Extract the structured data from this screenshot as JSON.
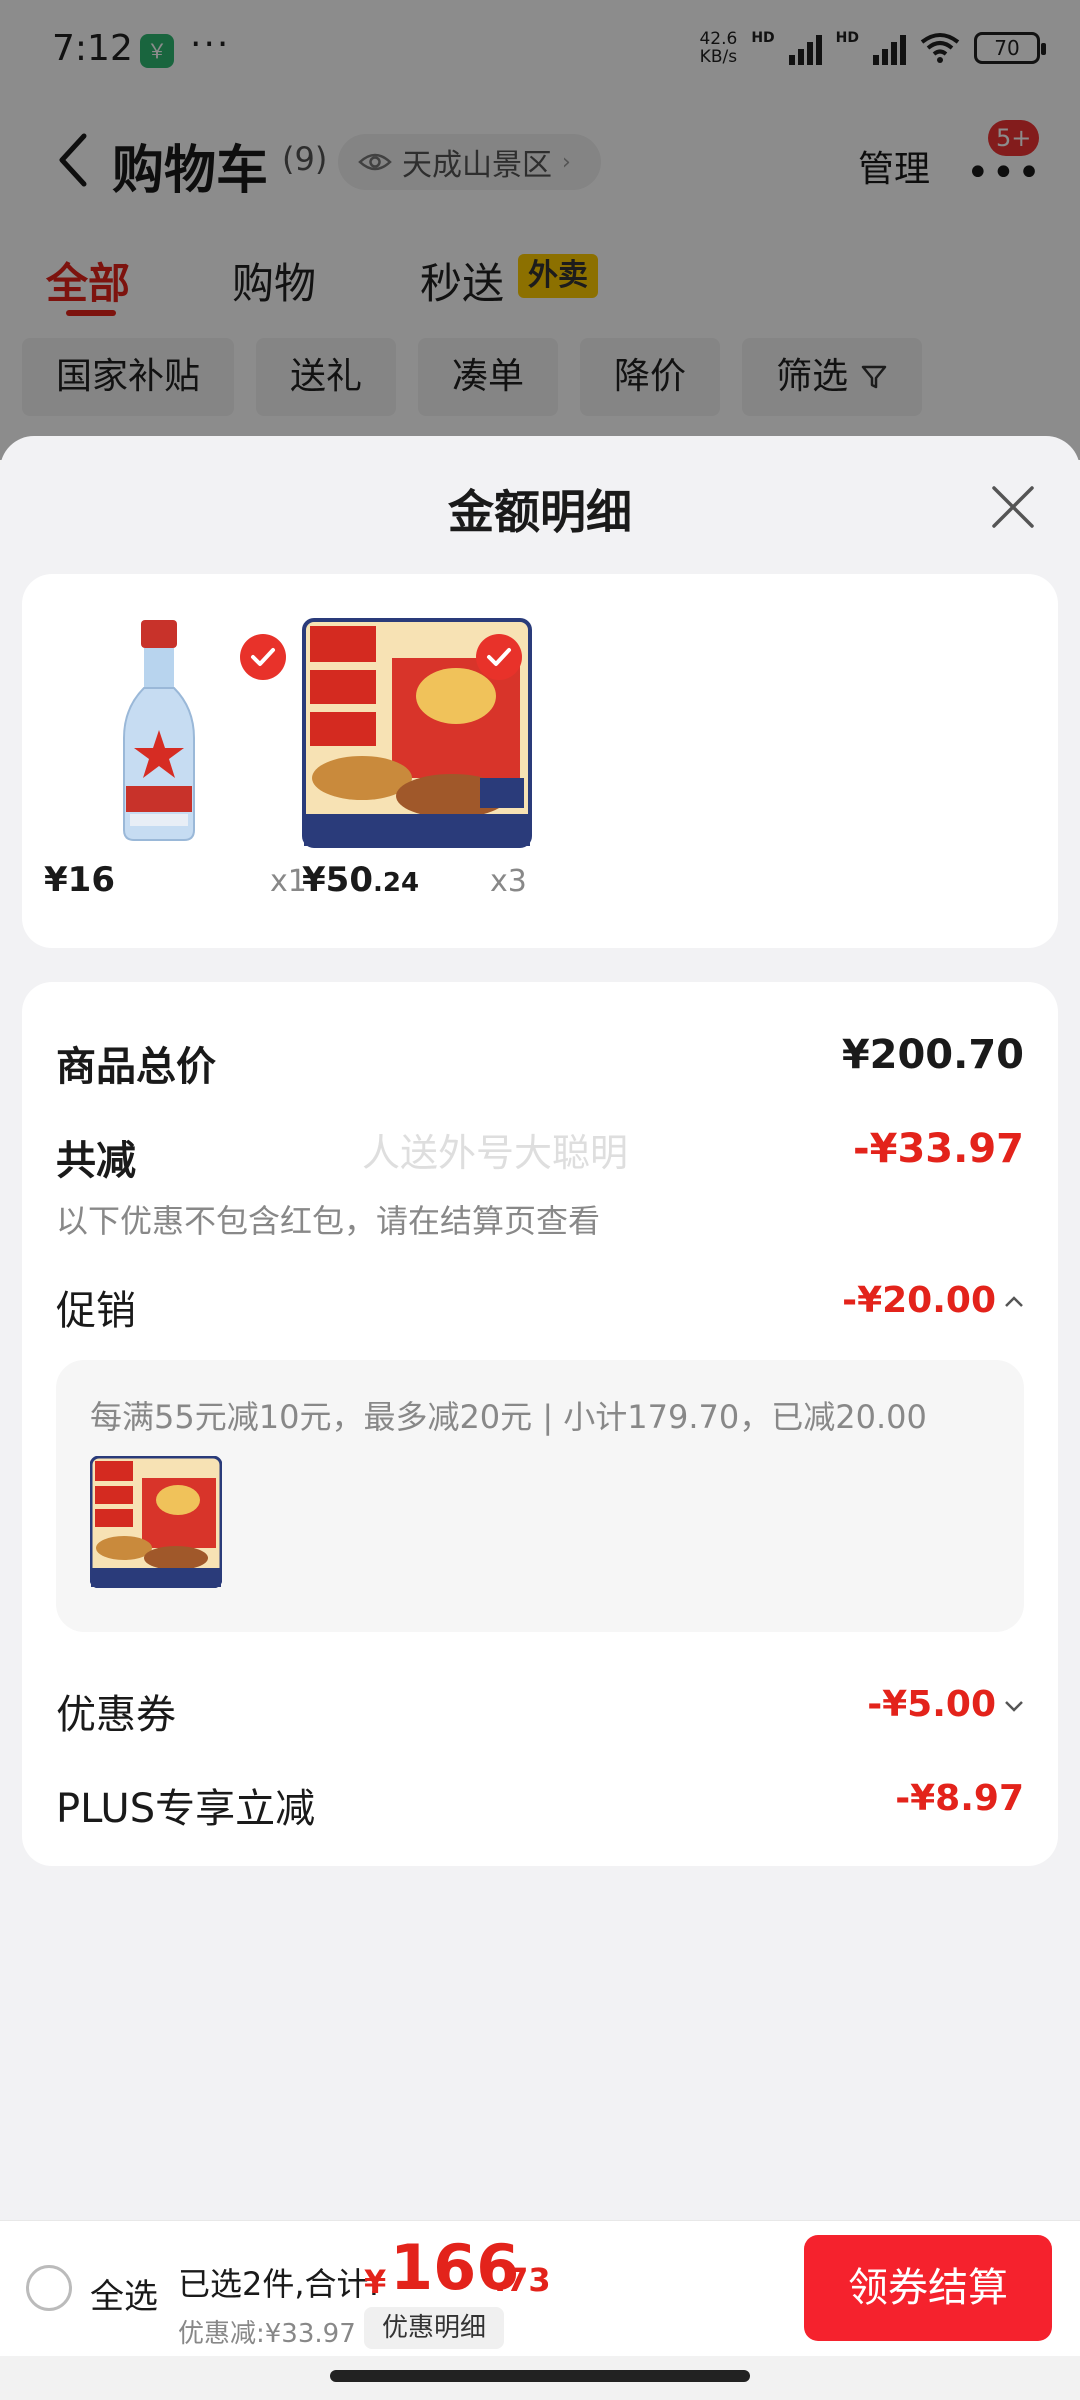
{
  "status_bar": {
    "time": "7:12",
    "more": "···",
    "net_speed_value": "42.6",
    "net_speed_unit": "KB/s",
    "hd1": "HD",
    "hd2": "HD",
    "battery": "70"
  },
  "nav": {
    "title": "购物车",
    "count": "(9)",
    "location": "天成山景区",
    "manage": "管理",
    "badge": "5+"
  },
  "tabs": [
    {
      "label": "全部",
      "active": true
    },
    {
      "label": "购物",
      "active": false
    },
    {
      "label": "秒送",
      "active": false
    }
  ],
  "tab_tag": "外卖",
  "chips": [
    "国家补贴",
    "送礼",
    "凑单",
    "降价",
    "筛选"
  ],
  "sheet": {
    "title": "金额明细",
    "products": [
      {
        "price_int": "¥16",
        "price_dec": "",
        "qty": "x1"
      },
      {
        "price_int": "¥50",
        "price_dec": ".24",
        "qty": "x3"
      }
    ],
    "total_label": "商品总价",
    "total_value": "¥200.70",
    "reduce_label": "共减",
    "reduce_value": "-¥33.97",
    "watermark": "人送外号大聪明",
    "reduce_note": "以下优惠不包含红包，请在结算页查看",
    "promo_label": "促销",
    "promo_value": "-¥20.00",
    "promo_detail": "每满55元减10元，最多减20元 | 小计179.70，已减20.00",
    "coupon_label": "优惠券",
    "coupon_value": "-¥5.00",
    "plus_label": "PLUS专享立减",
    "plus_value": "-¥8.97"
  },
  "action_bar": {
    "select_all": "全选",
    "selected_label": "已选2件,合计:",
    "total_symbol": "¥",
    "total_int": "166",
    "total_dec": ".73",
    "discount_label": "优惠减:¥33.97",
    "detail_button": "优惠明细",
    "checkout_button": "领券结算"
  },
  "colors": {
    "accent_red": "#e3231b",
    "checkout_red": "#f5222d",
    "tag_yellow": "#ffcc00"
  }
}
